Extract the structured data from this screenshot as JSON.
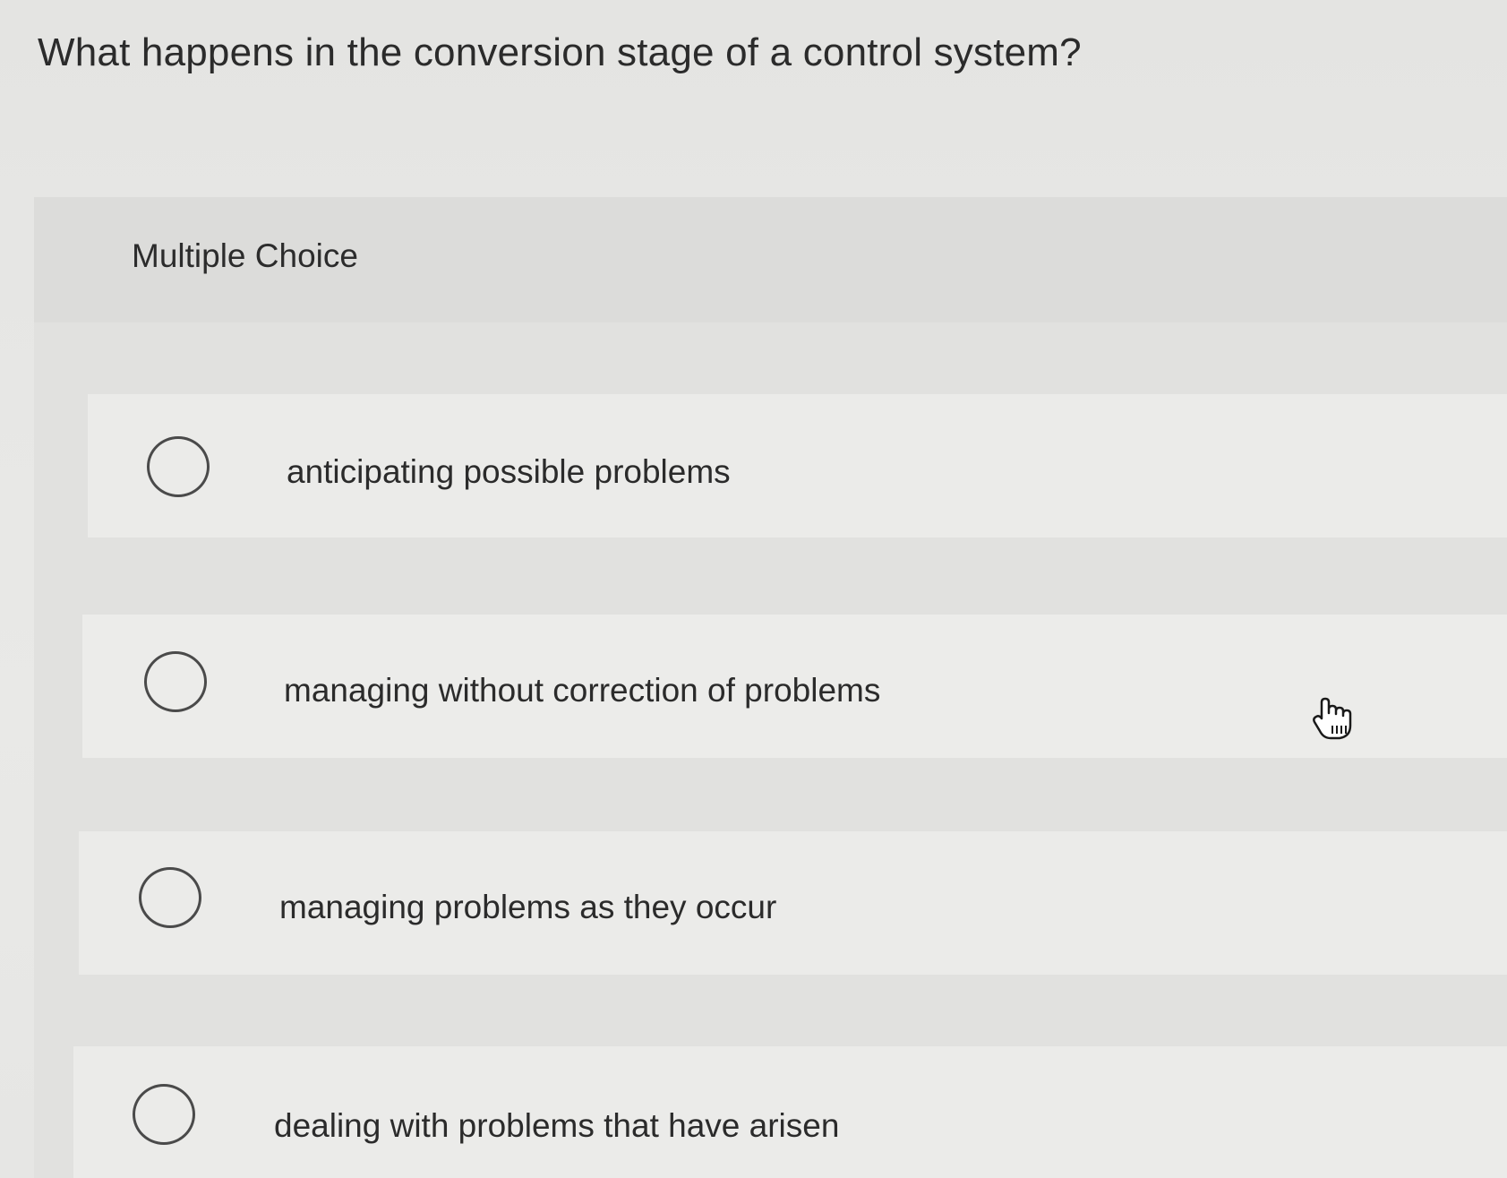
{
  "question": {
    "text": "What happens in the conversion stage of a control system?"
  },
  "multiple_choice": {
    "label": "Multiple Choice",
    "options": [
      {
        "text": "anticipating possible problems",
        "selected": false
      },
      {
        "text": "managing without correction of problems",
        "selected": false
      },
      {
        "text": "managing problems as they occur",
        "selected": false
      },
      {
        "text": "dealing with problems that have arisen",
        "selected": false
      }
    ]
  },
  "icons": {
    "radio": "radio-circle-icon",
    "cursor": "hand-pointer-icon"
  },
  "colors": {
    "background": "#e4e4e2",
    "text": "#2b2b2b",
    "radio_border": "#4a4a4a"
  }
}
